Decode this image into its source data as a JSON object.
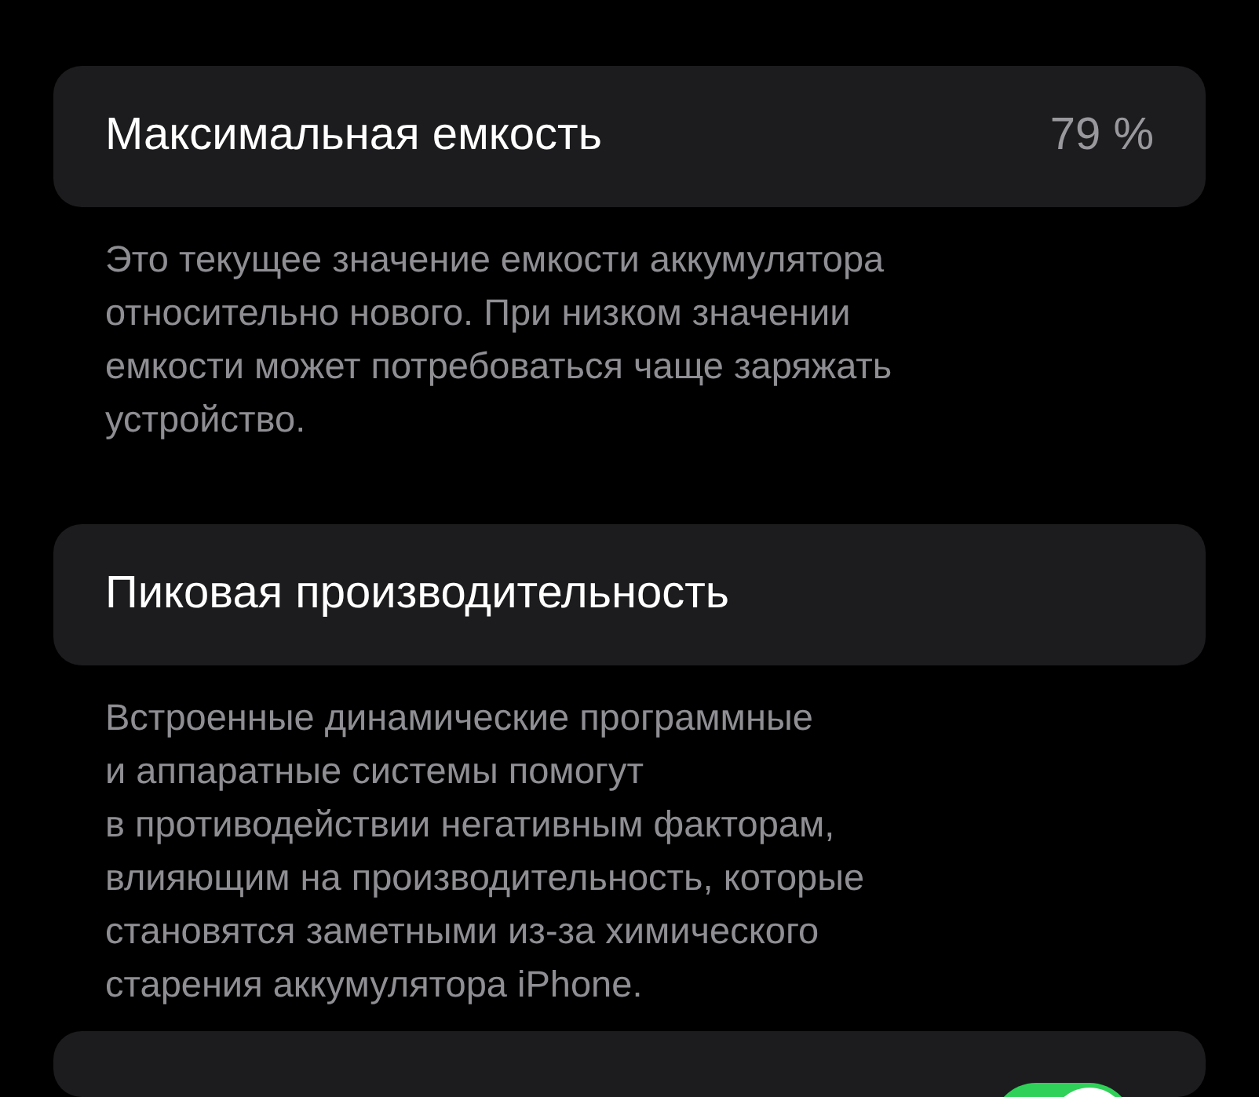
{
  "sections": [
    {
      "title": "Максимальная емкость",
      "value": "79 %",
      "footer": "Это текущее значение емкости аккумулятора\nотносительно нового. При низком значении\nемкости может потребоваться чаще заряжать\nустройство."
    },
    {
      "title": "Пиковая производительность",
      "footer": "Встроенные динамические программные\nи аппаратные системы помогут\nв противодействии негативным факторам,\nвлияющим на производительность, которые\nстановятся заметными из-за химического\nстарения аккумулятора iPhone."
    },
    {
      "toggle": {
        "on": true
      }
    }
  ]
}
